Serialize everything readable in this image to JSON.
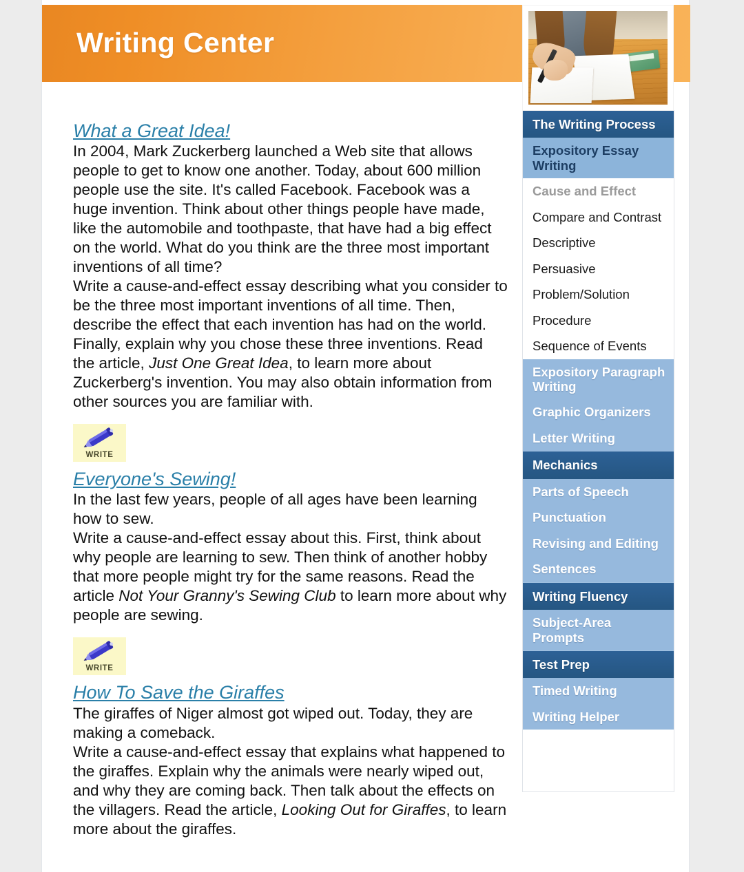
{
  "header": {
    "title": "Writing Center",
    "gradient_from": "#e98722",
    "gradient_to": "#f9b358"
  },
  "hero_photo": {
    "alt": "Girl writing in a notebook at a wooden desk with a calculator nearby"
  },
  "main": {
    "sections": [
      {
        "title": "What a Great Idea!",
        "intro": "In 2004, Mark Zuckerberg launched a Web site that allows people to get to know one another. Today, about 600 million people use the site. It's called Facebook. Facebook was a huge invention. Think about other things people have made, like the automobile and toothpaste, that have had a big effect on the world. What do you think are the three most important inventions of all time?",
        "task_before": "Write a cause-and-effect essay describing what you consider to be the three most important inventions of all time. Then, describe the effect that each invention has had on the world. Finally, explain why you chose these three inventions. Read the article, ",
        "task_italic": "Just One Great Idea",
        "task_after": ", to learn more about Zuckerberg's invention. You may also obtain information from other sources you are familiar with.",
        "write_label": "WRITE"
      },
      {
        "title": "Everyone's Sewing!",
        "intro": "In the last few years, people of all ages have been learning how to sew.",
        "task_before": "Write a cause-and-effect essay about this. First, think about why people are learning to sew. Then think of another hobby that more people might try for the same reasons. Read the article ",
        "task_italic": "Not Your Granny's Sewing Club",
        "task_after": " to learn more about why people are sewing.",
        "write_label": "WRITE"
      },
      {
        "title": "How To Save the Giraffes",
        "intro": "The giraffes of Niger almost got wiped out. Today, they are making a comeback.",
        "task_before": "Write a cause-and-effect essay that explains what happened to the giraffes. Explain why the animals were nearly wiped out, and why they are coming back. Then talk about the effects on the villagers. Read the article, ",
        "task_italic": "Looking Out for Giraffes",
        "task_after": ", to learn more about the giraffes.",
        "write_label": ""
      }
    ]
  },
  "sidebar": {
    "items": [
      {
        "label": "The Writing Process",
        "style": "head"
      },
      {
        "label": "Expository Essay Writing",
        "style": "active-branch"
      },
      {
        "label": "Cause and Effect",
        "style": "current"
      },
      {
        "label": "Compare and Contrast",
        "style": "leaf"
      },
      {
        "label": "Descriptive",
        "style": "leaf"
      },
      {
        "label": "Persuasive",
        "style": "leaf"
      },
      {
        "label": "Problem/Solution",
        "style": "leaf"
      },
      {
        "label": "Procedure",
        "style": "leaf"
      },
      {
        "label": "Sequence of Events",
        "style": "leaf"
      },
      {
        "label": "Expository Paragraph Writing",
        "style": "sub"
      },
      {
        "label": "Graphic Organizers",
        "style": "sub"
      },
      {
        "label": "Letter Writing",
        "style": "sub"
      },
      {
        "label": "Mechanics",
        "style": "head"
      },
      {
        "label": "Parts of Speech",
        "style": "sub"
      },
      {
        "label": "Punctuation",
        "style": "sub"
      },
      {
        "label": "Revising and Editing",
        "style": "sub"
      },
      {
        "label": "Sentences",
        "style": "sub"
      },
      {
        "label": "Writing Fluency",
        "style": "head"
      },
      {
        "label": "Subject-Area Prompts",
        "style": "sub"
      },
      {
        "label": "Test Prep",
        "style": "head"
      },
      {
        "label": "Timed Writing",
        "style": "sub"
      },
      {
        "label": "Writing Helper",
        "style": "sub"
      }
    ],
    "colors": {
      "head_bg": "#2d6196",
      "sub_bg": "#96b9dd",
      "active_branch_bg": "#8cb4da",
      "current_text": "#9a9a9a"
    }
  }
}
